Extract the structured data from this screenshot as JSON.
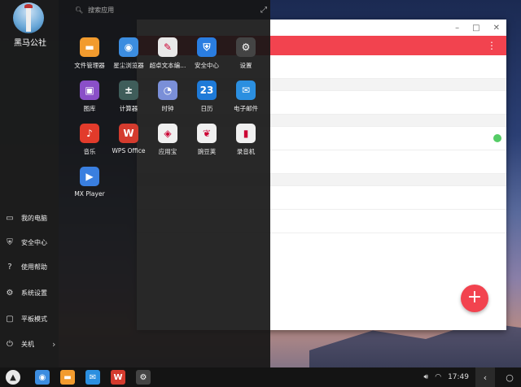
{
  "start_menu": {
    "username": "黑马公社",
    "search_placeholder": "搜索应用",
    "expand_icon": "expand-icon",
    "apps": [
      {
        "label": "文件管理器",
        "icon": "folder-icon",
        "color": "#f29b2e",
        "glyph": "▬"
      },
      {
        "label": "星尘浏览器",
        "icon": "browser-icon",
        "color": "#3c8de0",
        "glyph": "◉"
      },
      {
        "label": "超卓文本编...",
        "icon": "text-editor-icon",
        "color": "#e8e8e8",
        "glyph": "✎"
      },
      {
        "label": "安全中心",
        "icon": "security-shield-icon",
        "color": "#2a7de1",
        "glyph": "⛨"
      },
      {
        "label": "设置",
        "icon": "gear-icon",
        "color": "#444444",
        "glyph": "⚙"
      },
      {
        "label": "图库",
        "icon": "gallery-icon",
        "color": "#8a4fc8",
        "glyph": "▣"
      },
      {
        "label": "计算器",
        "icon": "calculator-icon",
        "color": "#3f5d5a",
        "glyph": "±"
      },
      {
        "label": "时钟",
        "icon": "clock-icon",
        "color": "#7a8fd8",
        "glyph": "◔"
      },
      {
        "label": "日历",
        "icon": "calendar-icon",
        "color": "#1e7ad8",
        "glyph": "23"
      },
      {
        "label": "电子邮件",
        "icon": "email-icon",
        "color": "#2b8fe0",
        "glyph": "✉"
      },
      {
        "label": "音乐",
        "icon": "music-icon",
        "color": "#e23b2b",
        "glyph": "♪"
      },
      {
        "label": "WPS Office",
        "icon": "wps-office-icon",
        "color": "#d43b2e",
        "glyph": "W"
      },
      {
        "label": "应用宝",
        "icon": "app-store-icon",
        "color": "#f0f0f0",
        "glyph": "◈"
      },
      {
        "label": "豌豆荚",
        "icon": "wandoujia-icon",
        "color": "#f0f0f0",
        "glyph": "❦"
      },
      {
        "label": "录音机",
        "icon": "recorder-icon",
        "color": "#f0f0f0",
        "glyph": "▮"
      },
      {
        "label": "MX Player",
        "icon": "mx-player-icon",
        "color": "#3a7fe0",
        "glyph": "▶"
      }
    ],
    "left_items": [
      {
        "label": "我的电脑",
        "icon": "folder-icon",
        "glyph": "▭"
      },
      {
        "label": "安全中心",
        "icon": "shield-icon",
        "glyph": "⛨"
      },
      {
        "label": "使用帮助",
        "icon": "help-icon",
        "glyph": "?"
      },
      {
        "label": "系统设置",
        "icon": "gear-icon",
        "glyph": "⚙"
      },
      {
        "label": "平板模式",
        "icon": "tablet-mode-icon",
        "glyph": "▢"
      },
      {
        "label": "关机",
        "icon": "power-icon",
        "glyph": "⏻"
      }
    ]
  },
  "app_window": {
    "window_controls": [
      "–",
      "□",
      "✕"
    ],
    "menu_glyph": "⋮",
    "fab_glyph": "+"
  },
  "taskbar": {
    "time": "17:49",
    "pinned": [
      {
        "icon": "browser-icon",
        "color": "#3c8de0",
        "glyph": "◉"
      },
      {
        "icon": "folder-icon",
        "color": "#f29b2e",
        "glyph": "▬"
      },
      {
        "icon": "email-icon",
        "color": "#2b8fe0",
        "glyph": "✉"
      },
      {
        "icon": "wps-office-icon",
        "color": "#d43b2e",
        "glyph": "W"
      },
      {
        "icon": "gear-icon",
        "color": "#444444",
        "glyph": "⚙"
      }
    ]
  }
}
